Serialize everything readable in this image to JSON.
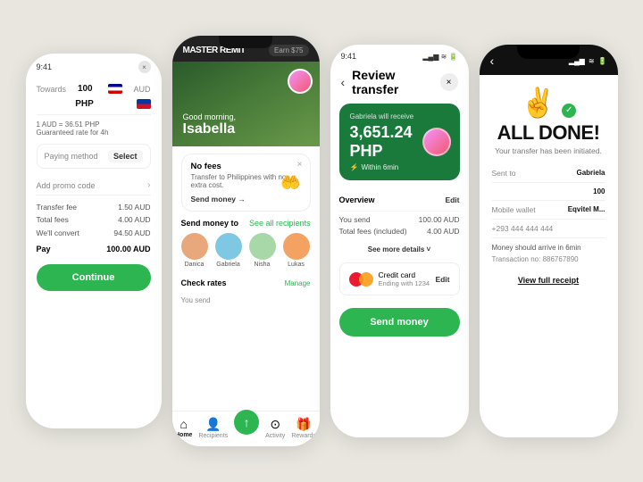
{
  "phone1": {
    "status_time": "9:41",
    "close_icon": "×",
    "towards_label": "Towards",
    "towards_value": "100",
    "currency_from": "AUD",
    "currency_to": "PHP",
    "rate_label": "1 AUD = 36.51 PHP",
    "rate_note": "Guaranteed rate for 4h",
    "paying_method_label": "Paying method",
    "select_label": "Select",
    "promo_label": "Add promo code",
    "transfer_fee_label": "Transfer fee",
    "transfer_fee_value": "1.50 AUD",
    "total_fees_label": "Total fees",
    "total_fees_value": "4.00 AUD",
    "convert_label": "We'll convert",
    "convert_value": "94.50 AUD",
    "pay_label": "Pay",
    "pay_value": "100.00 AUD",
    "continue_label": "Continue"
  },
  "phone2": {
    "status_time": "9:41",
    "logo_text": "MASTER REMIT",
    "earn_label": "Earn $75",
    "good_morning": "Good morning,",
    "name": "Isabella",
    "no_fees_title": "No fees",
    "no_fees_sub": "Transfer to Philippines with no extra cost.",
    "send_money_link": "Send money →",
    "nf_close": "×",
    "nf_icon": "🤲",
    "send_money_to": "Send money to",
    "see_all": "See all recipients",
    "recipients": [
      {
        "name": "Danica",
        "color": "#e8a87c"
      },
      {
        "name": "Gabriela",
        "color": "#7ec8e3"
      },
      {
        "name": "Nisha",
        "color": "#a8d8a8"
      },
      {
        "name": "Lukas",
        "color": "#f4a261"
      }
    ],
    "check_rates": "Check rates",
    "manage": "Manage",
    "you_send": "You send",
    "nav": [
      {
        "label": "Home",
        "icon": "⌂",
        "active": true
      },
      {
        "label": "Recipients",
        "icon": "👤",
        "active": false
      },
      {
        "label": "",
        "icon": "↑",
        "active": false,
        "is_send": true
      },
      {
        "label": "Activity",
        "icon": "⊙",
        "active": false
      },
      {
        "label": "Rewards",
        "icon": "🎁",
        "active": false
      }
    ]
  },
  "phone3": {
    "status_time": "9:41",
    "title": "Review transfer",
    "back_icon": "‹",
    "close_icon": "×",
    "receiver_label": "Gabriela will receive",
    "amount": "3,651.24 PHP",
    "within": "Within 6min",
    "overview_label": "Overview",
    "edit_label": "Edit",
    "you_send_label": "You send",
    "you_send_value": "100.00 AUD",
    "total_fees_label": "Total fees (included)",
    "total_fees_value": "4.00 AUD",
    "see_more": "See more details ˅",
    "payment_label": "Credit card",
    "payment_sub": "Ending with 1234",
    "payment_edit": "Edit",
    "send_money_label": "Send money"
  },
  "phone4": {
    "status_time": "9:41",
    "back_icon": "‹",
    "hand_icon": "✌️",
    "all_done": "ALL DONE!",
    "initiated": "Your transfer has been initiated.",
    "sent_to_label": "Sent to",
    "sent_to_value": "Gabriela",
    "amount_label": "100",
    "mobile_wallet_label": "Mobile wallet",
    "mobile_wallet_value": "Eqvitel M...",
    "phone_label": "+293 444 444 444",
    "arrives_label": "Money should arrive in 6min",
    "txn_label": "Transaction no:",
    "txn_value": "886767890",
    "receipt_label": "View full receipt",
    "green_check": "✓"
  }
}
